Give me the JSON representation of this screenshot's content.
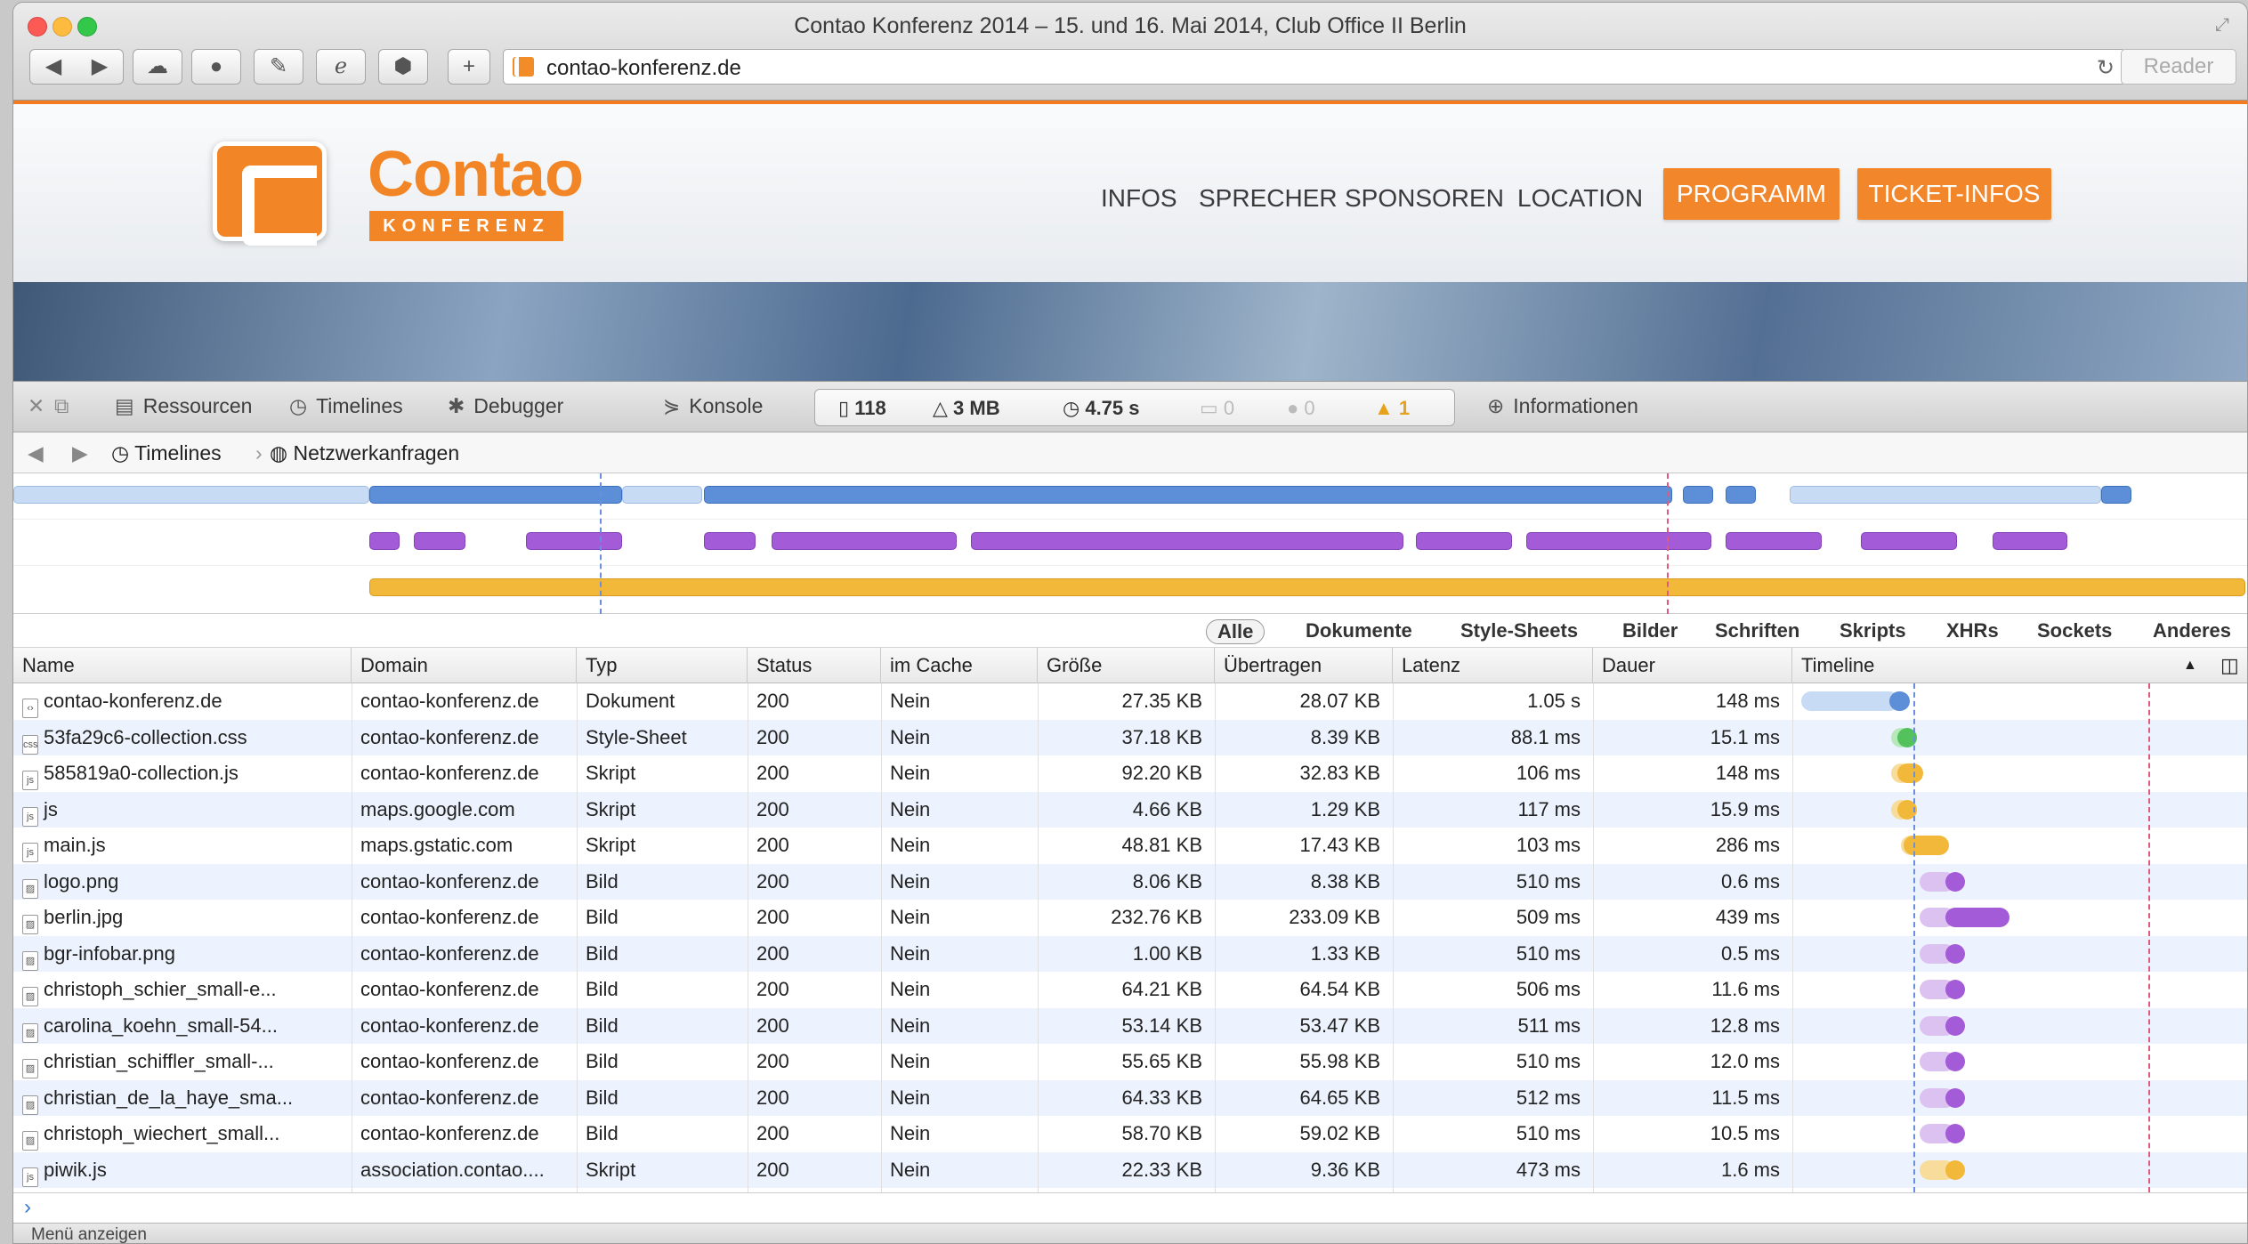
{
  "window": {
    "title": "Contao Konferenz 2014 – 15. und 16. Mai 2014, Club Office II Berlin"
  },
  "toolbar": {
    "url": "contao-konferenz.de",
    "reader_label": "Reader"
  },
  "site": {
    "logo_word": "Contao",
    "logo_sub": "KONFERENZ",
    "nav": [
      "INFOS",
      "SPRECHER",
      "SPONSOREN",
      "LOCATION"
    ],
    "nav_buttons": [
      "PROGRAMM",
      "TICKET-INFOS"
    ]
  },
  "inspector": {
    "tabs": {
      "resources": "Ressourcen",
      "timelines": "Timelines",
      "debugger": "Debugger",
      "console": "Konsole",
      "info": "Informationen"
    },
    "stats": {
      "requests": "118",
      "size": "3 MB",
      "time": "4.75 s",
      "logs": "0",
      "errors": "0",
      "warnings": "1"
    },
    "breadcrumb": {
      "timelines": "Timelines",
      "network": "Netzwerkanfragen"
    },
    "filters": [
      "Alle",
      "Dokumente",
      "Style-Sheets",
      "Bilder",
      "Schriften",
      "Skripts",
      "XHRs",
      "Sockets",
      "Anderes"
    ],
    "columns": [
      "Name",
      "Domain",
      "Typ",
      "Status",
      "im Cache",
      "Größe",
      "Übertragen",
      "Latenz",
      "Dauer",
      "Timeline"
    ],
    "rows": [
      {
        "name": "contao-konferenz.de",
        "domain": "contao-konferenz.de",
        "type": "Dokument",
        "status": "200",
        "cache": "Nein",
        "size": "27.35 KB",
        "transferred": "28.07 KB",
        "latency": "1.05 s",
        "duration": "148 ms",
        "icon": "document-icon",
        "tl": {
          "start": 0.0,
          "wait": 0.55,
          "end": 0.68,
          "color": "#5d8fd9",
          "light": "#c7dbf4"
        }
      },
      {
        "name": "53fa29c6-collection.css",
        "domain": "contao-konferenz.de",
        "type": "Style-Sheet",
        "status": "200",
        "cache": "Nein",
        "size": "37.18 KB",
        "transferred": "8.39 KB",
        "latency": "88.1 ms",
        "duration": "15.1 ms",
        "icon": "stylesheet-icon",
        "tl": {
          "start": 0.56,
          "wait": 0.6,
          "end": 0.69,
          "color": "#53c25c",
          "light": "#b7e8b9"
        }
      },
      {
        "name": "585819a0-collection.js",
        "domain": "contao-konferenz.de",
        "type": "Skript",
        "status": "200",
        "cache": "Nein",
        "size": "92.20 KB",
        "transferred": "32.83 KB",
        "latency": "106 ms",
        "duration": "148 ms",
        "icon": "script-icon",
        "tl": {
          "start": 0.56,
          "wait": 0.6,
          "end": 0.76,
          "color": "#f2b83a",
          "light": "#f8dc9c"
        }
      },
      {
        "name": "js",
        "domain": "maps.google.com",
        "type": "Skript",
        "status": "200",
        "cache": "Nein",
        "size": "4.66 KB",
        "transferred": "1.29 KB",
        "latency": "117 ms",
        "duration": "15.9 ms",
        "icon": "script-icon",
        "tl": {
          "start": 0.56,
          "wait": 0.6,
          "end": 0.7,
          "color": "#f2b83a",
          "light": "#f8dc9c"
        }
      },
      {
        "name": "main.js",
        "domain": "maps.gstatic.com",
        "type": "Skript",
        "status": "200",
        "cache": "Nein",
        "size": "48.81 KB",
        "transferred": "17.43 KB",
        "latency": "103 ms",
        "duration": "286 ms",
        "icon": "script-icon",
        "tl": {
          "start": 0.62,
          "wait": 0.64,
          "end": 0.92,
          "color": "#f2b83a",
          "light": "#f8dc9c"
        }
      },
      {
        "name": "logo.png",
        "domain": "contao-konferenz.de",
        "type": "Bild",
        "status": "200",
        "cache": "Nein",
        "size": "8.06 KB",
        "transferred": "8.38 KB",
        "latency": "510 ms",
        "duration": "0.6 ms",
        "icon": "image-icon",
        "tl": {
          "start": 0.74,
          "wait": 0.9,
          "end": 1.0,
          "color": "#a45bd8",
          "light": "#dcc2f0"
        }
      },
      {
        "name": "berlin.jpg",
        "domain": "contao-konferenz.de",
        "type": "Bild",
        "status": "200",
        "cache": "Nein",
        "size": "232.76 KB",
        "transferred": "233.09 KB",
        "latency": "509 ms",
        "duration": "439 ms",
        "icon": "image-icon",
        "tl": {
          "start": 0.74,
          "wait": 0.9,
          "end": 1.3,
          "color": "#a45bd8",
          "light": "#dcc2f0"
        }
      },
      {
        "name": "bgr-infobar.png",
        "domain": "contao-konferenz.de",
        "type": "Bild",
        "status": "200",
        "cache": "Nein",
        "size": "1.00 KB",
        "transferred": "1.33 KB",
        "latency": "510 ms",
        "duration": "0.5 ms",
        "icon": "image-icon",
        "tl": {
          "start": 0.74,
          "wait": 0.9,
          "end": 1.0,
          "color": "#a45bd8",
          "light": "#dcc2f0"
        }
      },
      {
        "name": "christoph_schier_small-e...",
        "domain": "contao-konferenz.de",
        "type": "Bild",
        "status": "200",
        "cache": "Nein",
        "size": "64.21 KB",
        "transferred": "64.54 KB",
        "latency": "506 ms",
        "duration": "11.6 ms",
        "icon": "image-icon",
        "tl": {
          "start": 0.74,
          "wait": 0.9,
          "end": 1.02,
          "color": "#a45bd8",
          "light": "#dcc2f0"
        }
      },
      {
        "name": "carolina_koehn_small-54...",
        "domain": "contao-konferenz.de",
        "type": "Bild",
        "status": "200",
        "cache": "Nein",
        "size": "53.14 KB",
        "transferred": "53.47 KB",
        "latency": "511 ms",
        "duration": "12.8 ms",
        "icon": "image-icon",
        "tl": {
          "start": 0.74,
          "wait": 0.9,
          "end": 1.02,
          "color": "#a45bd8",
          "light": "#dcc2f0"
        }
      },
      {
        "name": "christian_schiffler_small-...",
        "domain": "contao-konferenz.de",
        "type": "Bild",
        "status": "200",
        "cache": "Nein",
        "size": "55.65 KB",
        "transferred": "55.98 KB",
        "latency": "510 ms",
        "duration": "12.0 ms",
        "icon": "image-icon",
        "tl": {
          "start": 0.74,
          "wait": 0.9,
          "end": 1.02,
          "color": "#a45bd8",
          "light": "#dcc2f0"
        }
      },
      {
        "name": "christian_de_la_haye_sma...",
        "domain": "contao-konferenz.de",
        "type": "Bild",
        "status": "200",
        "cache": "Nein",
        "size": "64.33 KB",
        "transferred": "64.65 KB",
        "latency": "512 ms",
        "duration": "11.5 ms",
        "icon": "image-icon",
        "tl": {
          "start": 0.74,
          "wait": 0.9,
          "end": 1.02,
          "color": "#a45bd8",
          "light": "#dcc2f0"
        }
      },
      {
        "name": "christoph_wiechert_small...",
        "domain": "contao-konferenz.de",
        "type": "Bild",
        "status": "200",
        "cache": "Nein",
        "size": "58.70 KB",
        "transferred": "59.02 KB",
        "latency": "510 ms",
        "duration": "10.5 ms",
        "icon": "image-icon",
        "tl": {
          "start": 0.74,
          "wait": 0.9,
          "end": 1.02,
          "color": "#a45bd8",
          "light": "#dcc2f0"
        }
      },
      {
        "name": "piwik.js",
        "domain": "association.contao....",
        "type": "Skript",
        "status": "200",
        "cache": "Nein",
        "size": "22.33 KB",
        "transferred": "9.36 KB",
        "latency": "473 ms",
        "duration": "1.6 ms",
        "icon": "script-icon",
        "tl": {
          "start": 0.74,
          "wait": 0.9,
          "end": 1.0,
          "color": "#f2b83a",
          "light": "#f8dc9c"
        }
      }
    ]
  },
  "statusbar": {
    "label": "Menü anzeigen",
    "console_prompt": "›"
  }
}
